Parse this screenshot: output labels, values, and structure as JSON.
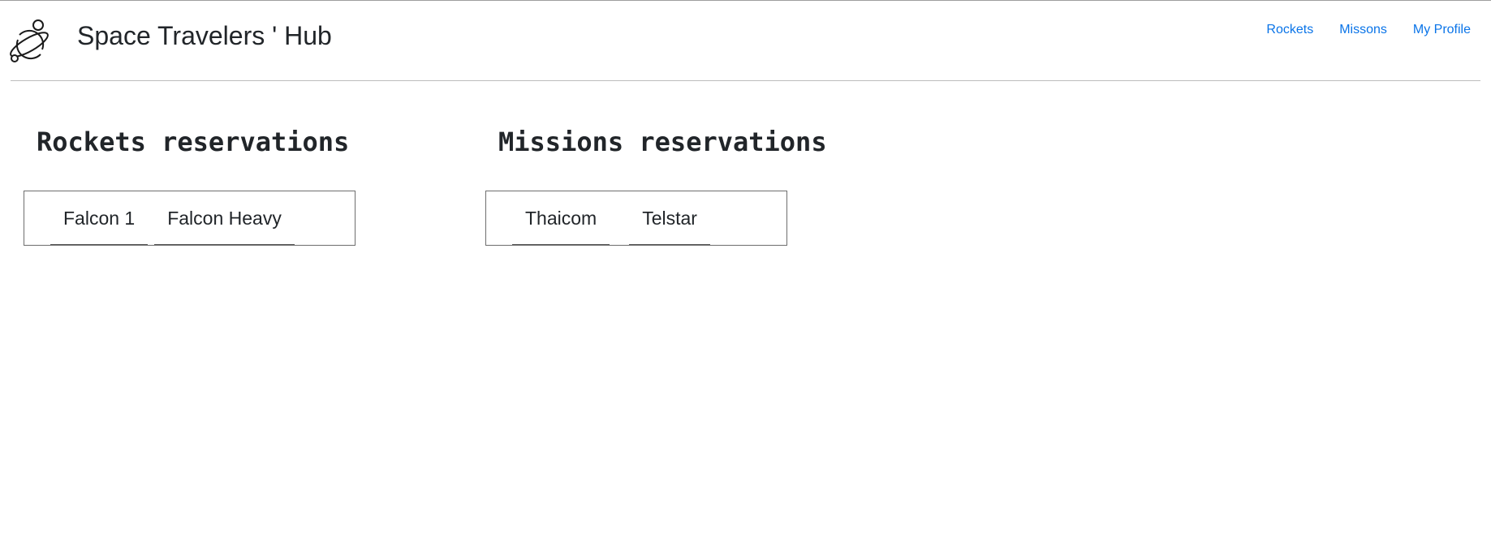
{
  "header": {
    "title": "Space Travelers ' Hub",
    "nav": [
      {
        "label": "Rockets"
      },
      {
        "label": "Missons"
      },
      {
        "label": "My Profile"
      }
    ]
  },
  "rockets": {
    "title": "Rockets reservations",
    "items": [
      "Falcon 1",
      "Falcon Heavy"
    ]
  },
  "missions": {
    "title": "Missions reservations",
    "items": [
      "Thaicom",
      "Telstar"
    ]
  },
  "colors": {
    "link": "#0a74e8",
    "text": "#212529",
    "border": "#6e6e6e"
  },
  "icons": {
    "logo": "planet-icon"
  }
}
